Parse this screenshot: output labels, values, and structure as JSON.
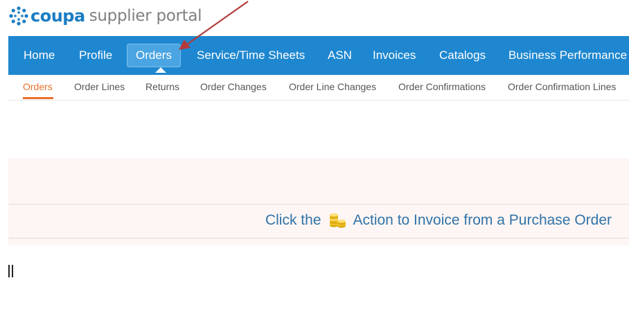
{
  "logo": {
    "brand": "coupa",
    "product": "supplier portal"
  },
  "topnav": {
    "items": [
      {
        "label": "Home"
      },
      {
        "label": "Profile"
      },
      {
        "label": "Orders",
        "active": true
      },
      {
        "label": "Service/Time Sheets"
      },
      {
        "label": "ASN"
      },
      {
        "label": "Invoices"
      },
      {
        "label": "Catalogs"
      },
      {
        "label": "Business Performance"
      }
    ]
  },
  "subnav": {
    "items": [
      {
        "label": "Orders",
        "active": true
      },
      {
        "label": "Order Lines"
      },
      {
        "label": "Returns"
      },
      {
        "label": "Order Changes"
      },
      {
        "label": "Order Line Changes"
      },
      {
        "label": "Order Confirmations"
      },
      {
        "label": "Order Confirmation Lines"
      }
    ]
  },
  "notice": {
    "prefix": "Click the",
    "icon": "coins-invoice-icon",
    "suffix": "Action to Invoice from a Purchase Order"
  },
  "colors": {
    "nav_bg": "#1e87d0",
    "nav_active": "#4aa5e2",
    "subnav_active": "#e7702d",
    "notice_text": "#3173a7",
    "annotation_arrow": "#b33a3a"
  }
}
